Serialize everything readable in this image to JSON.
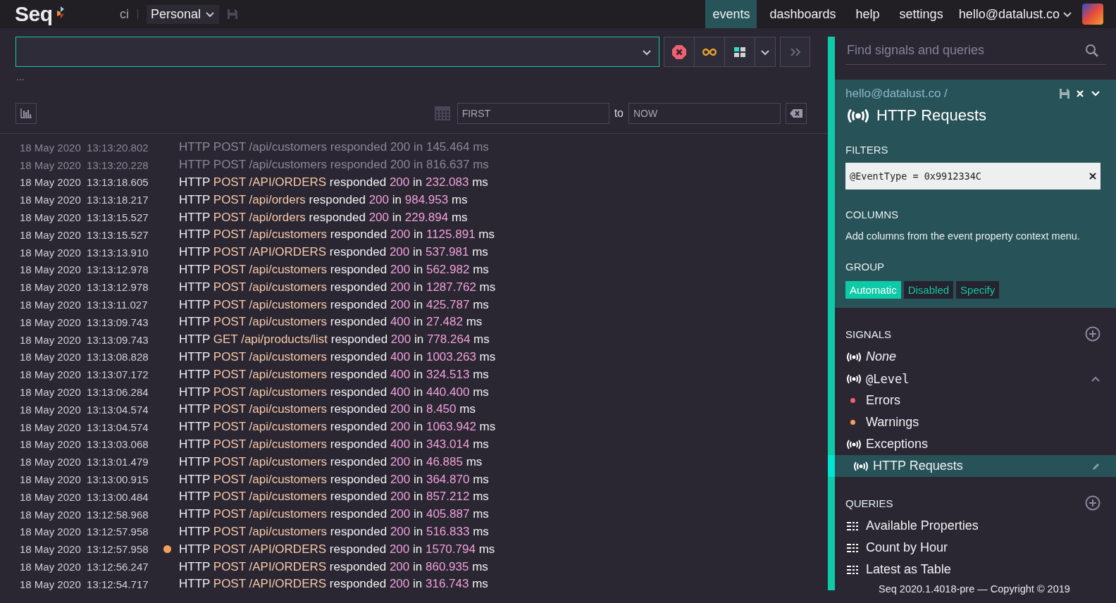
{
  "topbar": {
    "logo": "Seq",
    "instance": "ci",
    "workspace": "Personal",
    "nav": [
      {
        "label": "events",
        "selected": true
      },
      {
        "label": "dashboards",
        "selected": false
      },
      {
        "label": "help",
        "selected": false
      },
      {
        "label": "settings",
        "selected": false
      }
    ],
    "user": "hello@datalust.co"
  },
  "search": {
    "ellipsis": "..."
  },
  "range": {
    "from_placeholder": "FIRST",
    "to": "to",
    "to_placeholder": "NOW"
  },
  "events": [
    {
      "time": "18 May 2020  13:13:20.802",
      "dimmed": true,
      "warning": false,
      "message": [
        "HTTP",
        "POST /api/customers",
        "responded",
        "200",
        "in",
        "145.464",
        "ms"
      ]
    },
    {
      "time": "18 May 2020  13:13:20.228",
      "dimmed": true,
      "warning": false,
      "message": [
        "HTTP",
        "POST /api/customers",
        "responded",
        "200",
        "in",
        "816.637",
        "ms"
      ]
    },
    {
      "time": "18 May 2020  13:13:18.605",
      "dimmed": false,
      "warning": false,
      "message": [
        "HTTP",
        "POST /API/ORDERS",
        "responded",
        "200",
        "in",
        "232.083",
        "ms"
      ]
    },
    {
      "time": "18 May 2020  13:13:18.217",
      "dimmed": false,
      "warning": false,
      "message": [
        "HTTP",
        "POST /api/orders",
        "responded",
        "200",
        "in",
        "984.953",
        "ms"
      ]
    },
    {
      "time": "18 May 2020  13:13:15.527",
      "dimmed": false,
      "warning": false,
      "message": [
        "HTTP",
        "POST /api/orders",
        "responded",
        "200",
        "in",
        "229.894",
        "ms"
      ]
    },
    {
      "time": "18 May 2020  13:13:15.527",
      "dimmed": false,
      "warning": false,
      "message": [
        "HTTP",
        "POST /api/customers",
        "responded",
        "200",
        "in",
        "1125.891",
        "ms"
      ]
    },
    {
      "time": "18 May 2020  13:13:13.910",
      "dimmed": false,
      "warning": false,
      "message": [
        "HTTP",
        "POST /API/ORDERS",
        "responded",
        "200",
        "in",
        "537.981",
        "ms"
      ]
    },
    {
      "time": "18 May 2020  13:13:12.978",
      "dimmed": false,
      "warning": false,
      "message": [
        "HTTP",
        "POST /api/customers",
        "responded",
        "200",
        "in",
        "562.982",
        "ms"
      ]
    },
    {
      "time": "18 May 2020  13:13:12.978",
      "dimmed": false,
      "warning": false,
      "message": [
        "HTTP",
        "POST /api/customers",
        "responded",
        "200",
        "in",
        "1287.762",
        "ms"
      ]
    },
    {
      "time": "18 May 2020  13:13:11.027",
      "dimmed": false,
      "warning": false,
      "message": [
        "HTTP",
        "POST /api/customers",
        "responded",
        "200",
        "in",
        "425.787",
        "ms"
      ]
    },
    {
      "time": "18 May 2020  13:13:09.743",
      "dimmed": false,
      "warning": false,
      "message": [
        "HTTP",
        "POST /api/customers",
        "responded",
        "400",
        "in",
        "27.482",
        "ms"
      ]
    },
    {
      "time": "18 May 2020  13:13:09.743",
      "dimmed": false,
      "warning": false,
      "message": [
        "HTTP",
        "GET /api/products/list",
        "responded",
        "200",
        "in",
        "778.264",
        "ms"
      ]
    },
    {
      "time": "18 May 2020  13:13:08.828",
      "dimmed": false,
      "warning": false,
      "message": [
        "HTTP",
        "POST /api/customers",
        "responded",
        "400",
        "in",
        "1003.263",
        "ms"
      ]
    },
    {
      "time": "18 May 2020  13:13:07.172",
      "dimmed": false,
      "warning": false,
      "message": [
        "HTTP",
        "POST /api/customers",
        "responded",
        "400",
        "in",
        "324.513",
        "ms"
      ]
    },
    {
      "time": "18 May 2020  13:13:06.284",
      "dimmed": false,
      "warning": false,
      "message": [
        "HTTP",
        "POST /api/customers",
        "responded",
        "400",
        "in",
        "440.400",
        "ms"
      ]
    },
    {
      "time": "18 May 2020  13:13:04.574",
      "dimmed": false,
      "warning": false,
      "message": [
        "HTTP",
        "POST /api/customers",
        "responded",
        "200",
        "in",
        "8.450",
        "ms"
      ]
    },
    {
      "time": "18 May 2020  13:13:04.574",
      "dimmed": false,
      "warning": false,
      "message": [
        "HTTP",
        "POST /api/customers",
        "responded",
        "200",
        "in",
        "1063.942",
        "ms"
      ]
    },
    {
      "time": "18 May 2020  13:13:03.068",
      "dimmed": false,
      "warning": false,
      "message": [
        "HTTP",
        "POST /api/customers",
        "responded",
        "400",
        "in",
        "343.014",
        "ms"
      ]
    },
    {
      "time": "18 May 2020  13:13:01.479",
      "dimmed": false,
      "warning": false,
      "message": [
        "HTTP",
        "POST /api/customers",
        "responded",
        "200",
        "in",
        "46.885",
        "ms"
      ]
    },
    {
      "time": "18 May 2020  13:13:00.915",
      "dimmed": false,
      "warning": false,
      "message": [
        "HTTP",
        "POST /api/customers",
        "responded",
        "200",
        "in",
        "364.870",
        "ms"
      ]
    },
    {
      "time": "18 May 2020  13:13:00.484",
      "dimmed": false,
      "warning": false,
      "message": [
        "HTTP",
        "POST /api/customers",
        "responded",
        "200",
        "in",
        "857.212",
        "ms"
      ]
    },
    {
      "time": "18 May 2020  13:12:58.968",
      "dimmed": false,
      "warning": false,
      "message": [
        "HTTP",
        "POST /api/customers",
        "responded",
        "200",
        "in",
        "405.887",
        "ms"
      ]
    },
    {
      "time": "18 May 2020  13:12:57.958",
      "dimmed": false,
      "warning": false,
      "message": [
        "HTTP",
        "POST /api/customers",
        "responded",
        "200",
        "in",
        "516.833",
        "ms"
      ]
    },
    {
      "time": "18 May 2020  13:12:57.958",
      "dimmed": false,
      "warning": true,
      "message": [
        "HTTP",
        "POST /API/ORDERS",
        "responded",
        "200",
        "in",
        "1570.794",
        "ms"
      ]
    },
    {
      "time": "18 May 2020  13:12:56.247",
      "dimmed": false,
      "warning": false,
      "message": [
        "HTTP",
        "POST /API/ORDERS",
        "responded",
        "200",
        "in",
        "860.935",
        "ms"
      ]
    },
    {
      "time": "18 May 2020  13:12:54.717",
      "dimmed": false,
      "warning": false,
      "message": [
        "HTTP",
        "POST /API/ORDERS",
        "responded",
        "200",
        "in",
        "316.743",
        "ms"
      ]
    }
  ],
  "sidebar": {
    "search_placeholder": "Find signals and queries",
    "signal_editor": {
      "owner": "hello@datalust.co /",
      "title": "HTTP Requests",
      "filters_heading": "FILTERS",
      "filter": "@EventType = 0x9912334C",
      "columns_heading": "COLUMNS",
      "columns_hint": "Add columns from the event property context menu.",
      "group_heading": "GROUP",
      "group_options": [
        {
          "label": "Automatic",
          "selected": true
        },
        {
          "label": "Disabled",
          "selected": false
        },
        {
          "label": "Specify",
          "selected": false
        }
      ]
    },
    "signals_heading": "SIGNALS",
    "signals": [
      {
        "kind": "none",
        "label": "None",
        "selected": false
      },
      {
        "kind": "property",
        "label": "@Level",
        "selected": false,
        "expanded": true,
        "children": [
          {
            "kind": "level",
            "label": "Errors",
            "color": "#f0606e",
            "selected": false
          },
          {
            "kind": "level",
            "label": "Warnings",
            "color": "#f5a05a",
            "selected": false
          }
        ]
      },
      {
        "kind": "signal",
        "label": "Exceptions",
        "selected": false
      },
      {
        "kind": "signal",
        "label": "HTTP Requests",
        "selected": true
      }
    ],
    "queries_heading": "QUERIES",
    "queries": [
      {
        "label": "Available Properties"
      },
      {
        "label": "Count by Hour"
      },
      {
        "label": "Latest as Table"
      }
    ],
    "footer": "Seq 2020.1.4018-pre — Copyright © 2019"
  }
}
